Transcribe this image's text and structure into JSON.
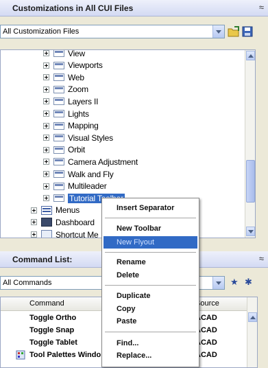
{
  "top_panel": {
    "title": "Customizations in All CUI Files",
    "collapse_glyph": "≈",
    "file_filter": "All Customization Files"
  },
  "tree": {
    "toolbar_items": [
      {
        "label": "View"
      },
      {
        "label": "Viewports"
      },
      {
        "label": "Web"
      },
      {
        "label": "Zoom"
      },
      {
        "label": "Layers II"
      },
      {
        "label": "Lights"
      },
      {
        "label": "Mapping"
      },
      {
        "label": "Visual Styles"
      },
      {
        "label": "Orbit"
      },
      {
        "label": "Camera Adjustment"
      },
      {
        "label": "Walk and Fly"
      },
      {
        "label": "Multileader"
      },
      {
        "label": "Tutorial Toolbar"
      }
    ],
    "root_items": [
      {
        "label": "Menus"
      },
      {
        "label": "Dashboard"
      },
      {
        "label": "Shortcut Me"
      }
    ]
  },
  "command_panel": {
    "title": "Command List:",
    "collapse_glyph": "≈",
    "filter": "All Commands",
    "columns": {
      "command": "Command",
      "source": "Source"
    },
    "rows": [
      {
        "command": "Toggle Ortho",
        "source": "ACAD"
      },
      {
        "command": "Toggle Snap",
        "source": "ACAD"
      },
      {
        "command": "Toggle Tablet",
        "source": "ACAD"
      },
      {
        "command": "Tool Palettes Windo",
        "source": "ACAD"
      }
    ]
  },
  "context_menu": {
    "items": [
      {
        "label": "Insert Separator"
      },
      {
        "label": "New Toolbar"
      },
      {
        "label": "New Flyout"
      },
      {
        "label": "Rename"
      },
      {
        "label": "Delete"
      },
      {
        "label": "Duplicate"
      },
      {
        "label": "Copy"
      },
      {
        "label": "Paste"
      },
      {
        "label": "Find..."
      },
      {
        "label": "Replace..."
      }
    ],
    "highlighted": "New Flyout"
  },
  "colors": {
    "selection": "#316ac5",
    "panel_header": "#d3daf3",
    "window_bg": "#ece9d8"
  }
}
